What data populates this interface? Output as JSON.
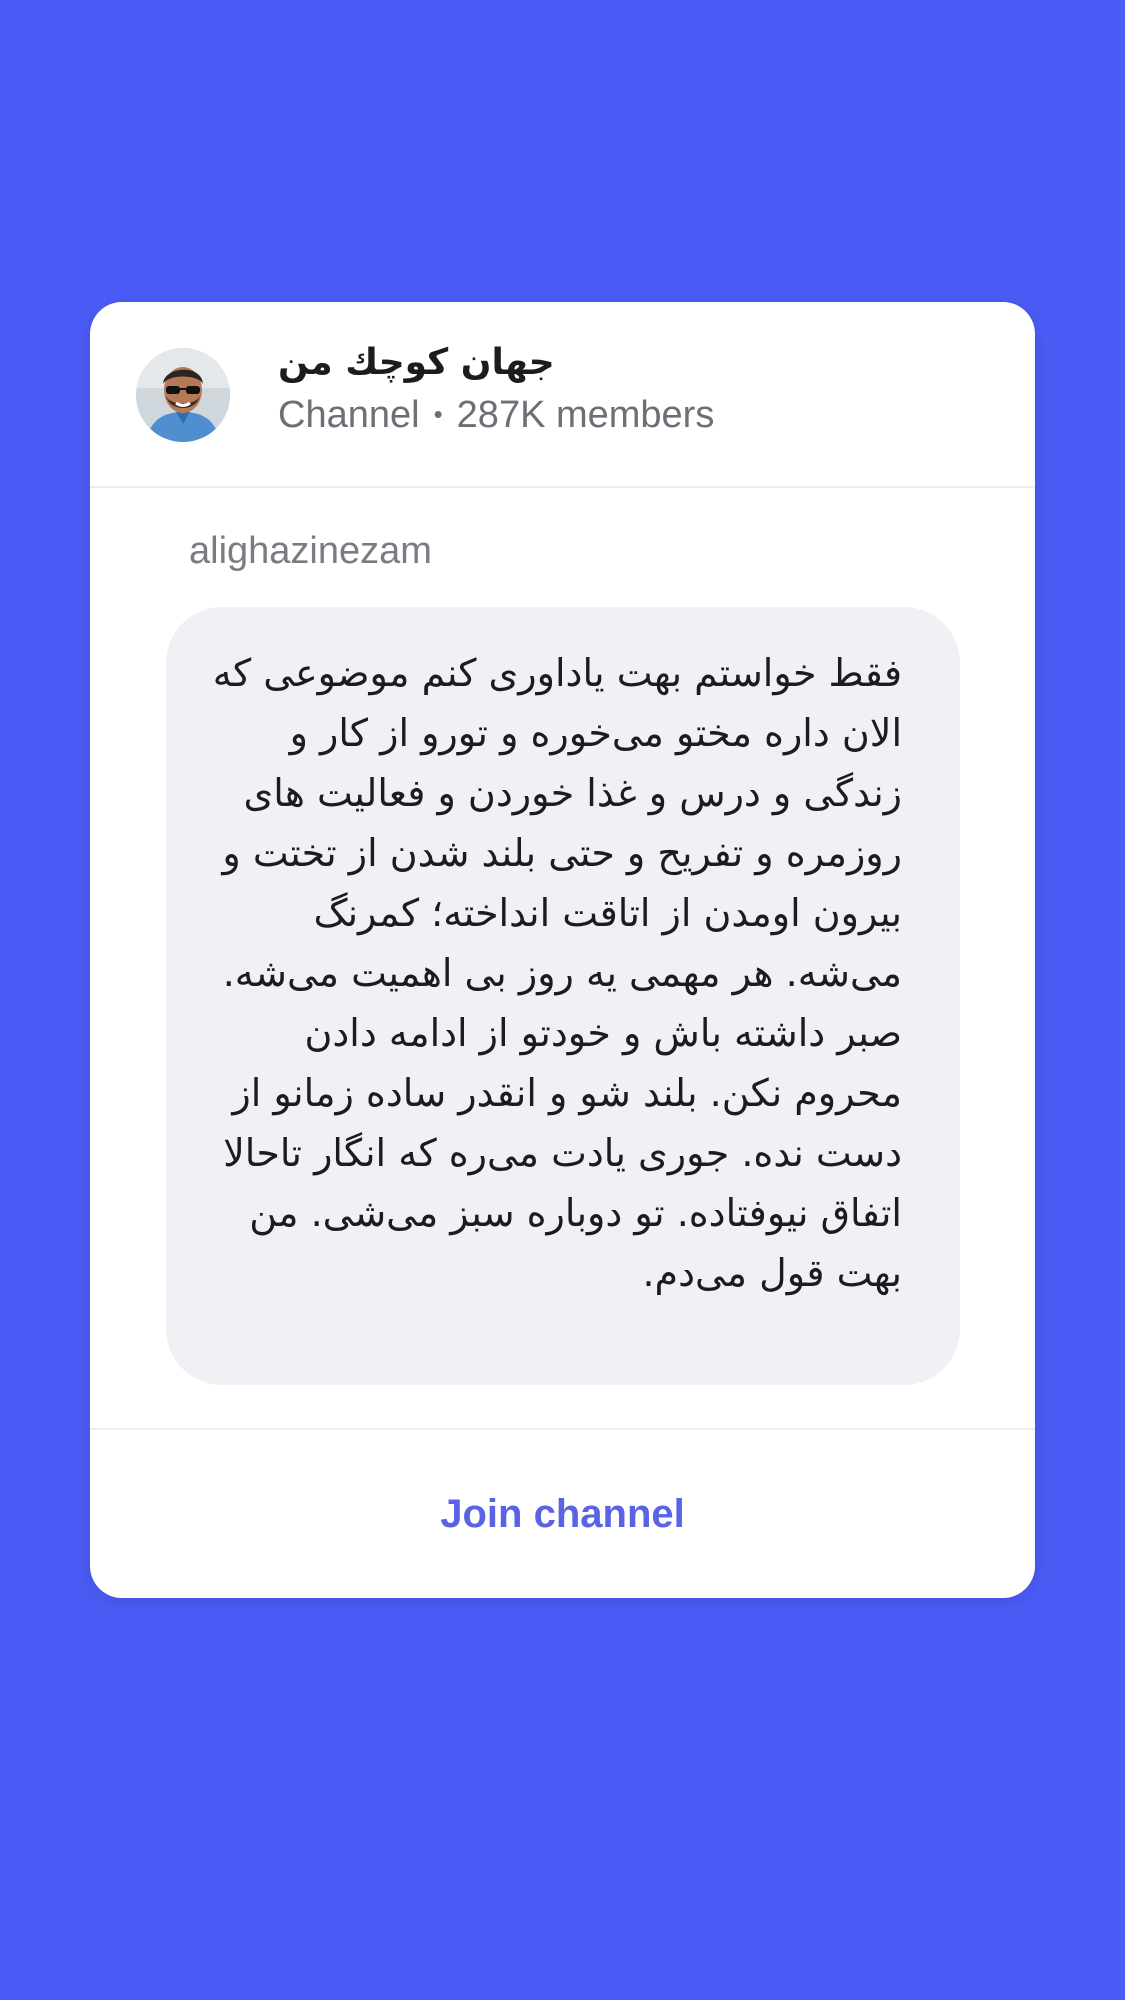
{
  "channel": {
    "name": "جهان کوچك من",
    "type": "Channel",
    "separator": "•",
    "members": "287K members"
  },
  "post": {
    "author": "alighazinezam",
    "text": "فقط خواستم بهت یاداوری کنم موضوعی که الان داره مختو می‌خوره و تورو از کار و زندگی و درس و غذا خوردن و فعالیت های روزمره و تفریح و حتی بلند شدن از تختت و بیرون اومدن از اتاقت انداخته؛ کمرنگ می‌شه. هر مهمی یه روز بی اهمیت می‌شه. صبر داشته باش و خودتو از ادامه دادن محروم نکن. بلند شو و انقدر ساده زمانو از دست نده. جوری یادت می‌ره که انگار تاحالا اتفاق نیوفتاده. تو دوباره سبز می‌شی. من بهت قول می‌دم."
  },
  "footer": {
    "join_label": "Join channel"
  },
  "colors": {
    "background": "#4b5cf6",
    "accent": "#5b63e5"
  }
}
